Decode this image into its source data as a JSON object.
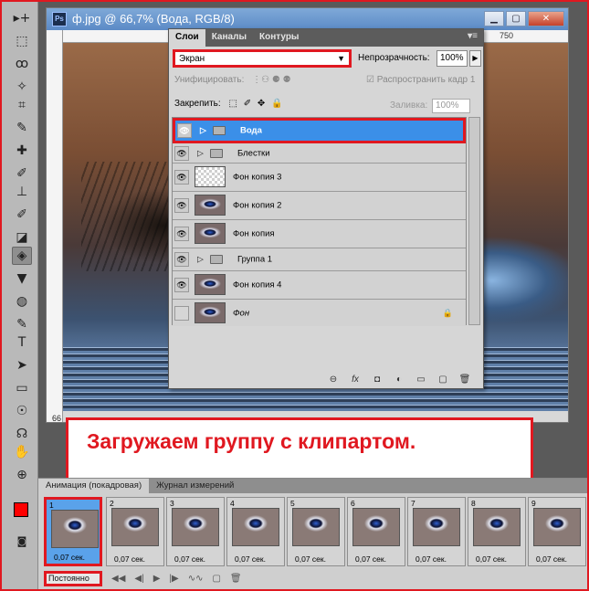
{
  "document": {
    "title": "ф.jpg @ 66,7% (Вода, RGB/8)",
    "ps_badge": "Ps",
    "ruler_marks": [
      "",
      "750"
    ],
    "zoom": "66"
  },
  "window_buttons": {
    "minimize": "▁",
    "maximize": "▢",
    "close": "✕"
  },
  "layers_panel": {
    "tabs": [
      "Слои",
      "Каналы",
      "Контуры"
    ],
    "blend_mode": "Экран",
    "opacity_label": "Непрозрачность:",
    "opacity_value": "100%",
    "unify_label": "Унифицировать:",
    "propagate_label": "Распространить кадр 1",
    "lock_label": "Закрепить:",
    "fill_label": "Заливка:",
    "fill_value": "100%",
    "layers": [
      {
        "name": "Вода",
        "type": "group",
        "selected": true,
        "visible": true
      },
      {
        "name": "Блестки",
        "type": "group",
        "selected": false,
        "visible": true
      },
      {
        "name": "Фон копия 3",
        "type": "layer",
        "selected": false,
        "visible": true
      },
      {
        "name": "Фон копия 2",
        "type": "layer",
        "selected": false,
        "visible": true
      },
      {
        "name": "Фон копия",
        "type": "layer",
        "selected": false,
        "visible": true
      },
      {
        "name": "Группа 1",
        "type": "group",
        "selected": false,
        "visible": true
      },
      {
        "name": "Фон копия 4",
        "type": "layer",
        "selected": false,
        "visible": true
      },
      {
        "name": "Фон",
        "type": "layer",
        "selected": false,
        "visible": false,
        "locked": true
      }
    ],
    "bottom_icons": [
      "link-icon",
      "fx-icon",
      "mask-icon",
      "adjustment-icon",
      "folder-icon",
      "new-layer-icon",
      "trash-icon"
    ],
    "bottom_glyphs": [
      "⊖",
      "fx",
      "◘",
      "◐",
      "▭",
      "▢",
      "🗑"
    ]
  },
  "caption": "Загружаем группу с клипартом.",
  "animation_panel": {
    "tabs": [
      "Анимация (покадровая)",
      "Журнал измерений"
    ],
    "frames": [
      {
        "num": "1",
        "delay": "0,07 сек.",
        "selected": true
      },
      {
        "num": "2",
        "delay": "0,07 сек.",
        "selected": false
      },
      {
        "num": "3",
        "delay": "0,07 сек.",
        "selected": false
      },
      {
        "num": "4",
        "delay": "0,07 сек.",
        "selected": false
      },
      {
        "num": "5",
        "delay": "0,07 сек.",
        "selected": false
      },
      {
        "num": "6",
        "delay": "0,07 сек.",
        "selected": false
      },
      {
        "num": "7",
        "delay": "0,07 сек.",
        "selected": false
      },
      {
        "num": "8",
        "delay": "0,07 сек.",
        "selected": false
      },
      {
        "num": "9",
        "delay": "0,07 сек.",
        "selected": false
      }
    ],
    "loop_value": "Постоянно",
    "control_glyphs": [
      "◀◀",
      "◀|",
      "▶",
      "|▶",
      "∿∿",
      "▢",
      "🗑"
    ]
  },
  "tools": [
    "▸+",
    "⬚",
    "ꝏ",
    "✧",
    "⌗",
    "✎",
    "✚",
    "✐",
    "⊥",
    "✐",
    "◪",
    "◈",
    "▼",
    "◍",
    "✎",
    "T",
    "➤",
    "▭",
    "☉",
    "☊",
    "✋",
    "⊕"
  ],
  "colors": {
    "accent_red": "#e01820",
    "selection_blue": "#3b8fe8",
    "foreground": "#ff0000",
    "background": "#ffffff"
  }
}
